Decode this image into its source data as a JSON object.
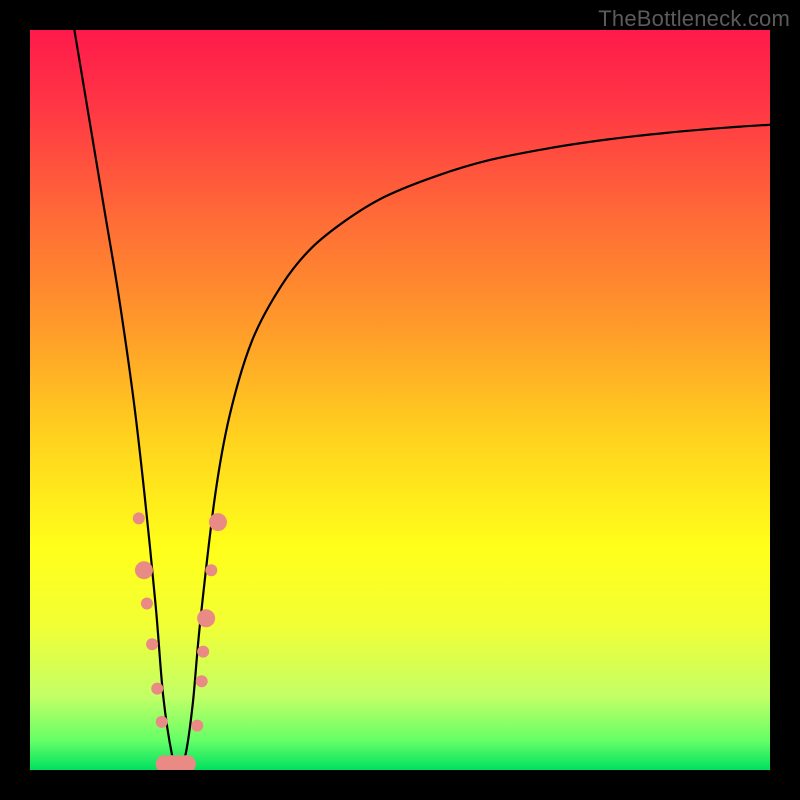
{
  "watermark": "TheBottleneck.com",
  "chart_data": {
    "type": "line",
    "title": "",
    "xlabel": "",
    "ylabel": "",
    "xlim": [
      0,
      100
    ],
    "ylim": [
      0,
      100
    ],
    "grid": false,
    "legend": false,
    "background_gradient": {
      "stops": [
        {
          "offset": 0.0,
          "color": "#ff1a4b"
        },
        {
          "offset": 0.1,
          "color": "#ff3545"
        },
        {
          "offset": 0.25,
          "color": "#ff6a37"
        },
        {
          "offset": 0.4,
          "color": "#ff9a2a"
        },
        {
          "offset": 0.55,
          "color": "#ffd21e"
        },
        {
          "offset": 0.7,
          "color": "#ffff1a"
        },
        {
          "offset": 0.8,
          "color": "#f3ff33"
        },
        {
          "offset": 0.9,
          "color": "#c3ff66"
        },
        {
          "offset": 0.96,
          "color": "#66ff66"
        },
        {
          "offset": 1.0,
          "color": "#00e060"
        }
      ]
    },
    "series": [
      {
        "name": "curve",
        "color": "#000000",
        "stroke_width": 2.2,
        "x": [
          6.0,
          8.0,
          10.0,
          12.0,
          14.0,
          15.5,
          17.0,
          18.0,
          19.2,
          20.0,
          21.0,
          22.0,
          23.0,
          25.0,
          27.0,
          30.0,
          34.0,
          38.0,
          43.0,
          48.0,
          55.0,
          62.0,
          70.0,
          78.0,
          86.0,
          94.0,
          100.0
        ],
        "y": [
          100.0,
          88.0,
          76.0,
          64.0,
          50.0,
          37.0,
          22.0,
          10.0,
          2.0,
          0.0,
          2.0,
          9.0,
          20.0,
          37.0,
          48.0,
          58.0,
          65.5,
          70.5,
          74.5,
          77.5,
          80.3,
          82.4,
          84.0,
          85.2,
          86.1,
          86.8,
          87.2
        ]
      }
    ],
    "markers": {
      "name": "highlight-dots",
      "color": "#e98a84",
      "radius_small": 6,
      "radius_large": 9,
      "points": [
        {
          "x": 14.7,
          "y": 34.0,
          "r": "small"
        },
        {
          "x": 15.4,
          "y": 27.0,
          "r": "large"
        },
        {
          "x": 15.8,
          "y": 22.5,
          "r": "small"
        },
        {
          "x": 16.5,
          "y": 17.0,
          "r": "small"
        },
        {
          "x": 17.2,
          "y": 11.0,
          "r": "small"
        },
        {
          "x": 17.8,
          "y": 6.5,
          "r": "small"
        },
        {
          "x": 18.2,
          "y": 0.8,
          "r": "large"
        },
        {
          "x": 19.2,
          "y": 0.8,
          "r": "large"
        },
        {
          "x": 20.2,
          "y": 0.8,
          "r": "large"
        },
        {
          "x": 21.2,
          "y": 0.8,
          "r": "large"
        },
        {
          "x": 22.6,
          "y": 6.0,
          "r": "small"
        },
        {
          "x": 23.2,
          "y": 12.0,
          "r": "small"
        },
        {
          "x": 23.4,
          "y": 16.0,
          "r": "small"
        },
        {
          "x": 23.8,
          "y": 20.5,
          "r": "large"
        },
        {
          "x": 24.5,
          "y": 27.0,
          "r": "small"
        },
        {
          "x": 25.4,
          "y": 33.5,
          "r": "large"
        }
      ]
    }
  }
}
